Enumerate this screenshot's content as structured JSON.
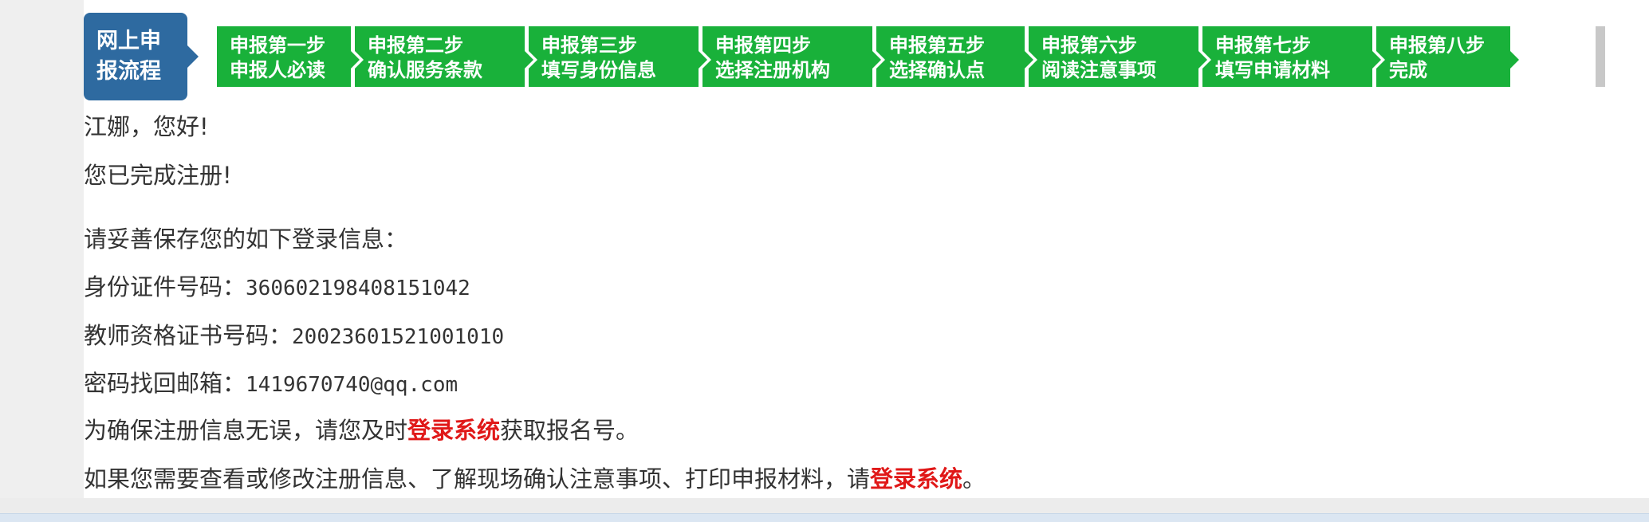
{
  "flow": {
    "title_line1": "网上申",
    "title_line2": "报流程",
    "steps": [
      {
        "line1": "申报第一步",
        "line2": "申报人必读"
      },
      {
        "line1": "申报第二步",
        "line2": "确认服务条款"
      },
      {
        "line1": "申报第三步",
        "line2": "填写身份信息"
      },
      {
        "line1": "申报第四步",
        "line2": "选择注册机构"
      },
      {
        "line1": "申报第五步",
        "line2": "选择确认点"
      },
      {
        "line1": "申报第六步",
        "line2": "阅读注意事项"
      },
      {
        "line1": "申报第七步",
        "line2": "填写申请材料"
      },
      {
        "line1": "申报第八步",
        "line2": "完成"
      }
    ],
    "colors": {
      "badge": "#2e6aa0",
      "step": "#19b13a"
    }
  },
  "message": {
    "greeting": "江娜，您好!",
    "done": "您已完成注册!",
    "save_hint": "请妥善保存您的如下登录信息：",
    "id_label": "身份证件号码：",
    "id_value": "360602198408151042",
    "cert_label": "教师资格证书号码：",
    "cert_value": "20023601521001010",
    "email_label": "密码找回邮箱：",
    "email_value": "1419670740@qq.com",
    "confirm_pre": "为确保注册信息无误，请您及时",
    "confirm_link": "登录系统",
    "confirm_post": "获取报名号。",
    "modify_pre": "如果您需要查看或修改注册信息、了解现场确认注意事项、打印申报材料，请",
    "modify_link": "登录系统",
    "modify_post": "。"
  }
}
